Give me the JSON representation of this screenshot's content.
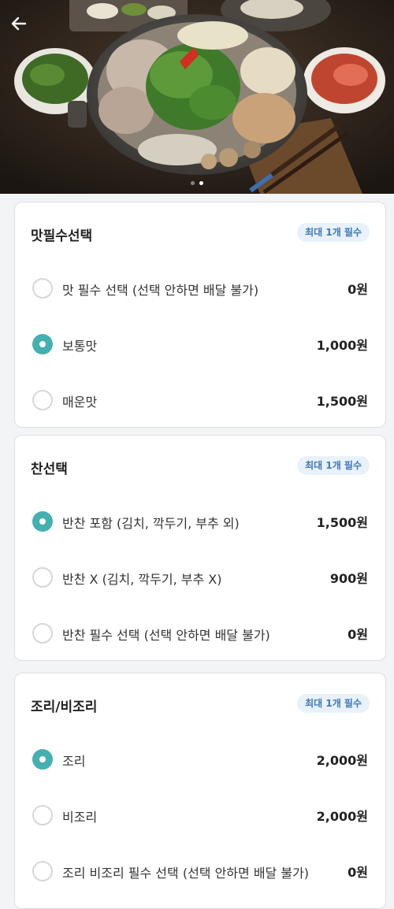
{
  "header": {
    "back_icon": "arrow-left-icon",
    "carousel": {
      "count": 2,
      "active": 1
    }
  },
  "option_groups": [
    {
      "title": "맛필수선택",
      "badge": "최대 1개 필수",
      "options": [
        {
          "label": "맛 필수 선택 (선택 안하면 배달 불가)",
          "price": "0원",
          "selected": false
        },
        {
          "label": "보통맛",
          "price": "1,000원",
          "selected": true
        },
        {
          "label": "매운맛",
          "price": "1,500원",
          "selected": false
        }
      ]
    },
    {
      "title": "찬선택",
      "badge": "최대 1개 필수",
      "options": [
        {
          "label": "반찬 포함 (김치, 깍두기, 부추 외)",
          "price": "1,500원",
          "selected": true
        },
        {
          "label": "반찬 X (김치, 깍두기, 부추 X)",
          "price": "900원",
          "selected": false
        },
        {
          "label": "반찬 필수 선택 (선택 안하면 배달 불가)",
          "price": "0원",
          "selected": false
        }
      ]
    },
    {
      "title": "조리/비조리",
      "badge": "최대 1개 필수",
      "options": [
        {
          "label": "조리",
          "price": "2,000원",
          "selected": true
        },
        {
          "label": "비조리",
          "price": "2,000원",
          "selected": false
        },
        {
          "label": "조리 비조리 필수 선택 (선택 안하면 배달 불가)",
          "price": "0원",
          "selected": false
        }
      ]
    }
  ],
  "colors": {
    "accent": "#45b0b0",
    "badge_bg": "#e9f2fb",
    "badge_text": "#3f78b5"
  }
}
